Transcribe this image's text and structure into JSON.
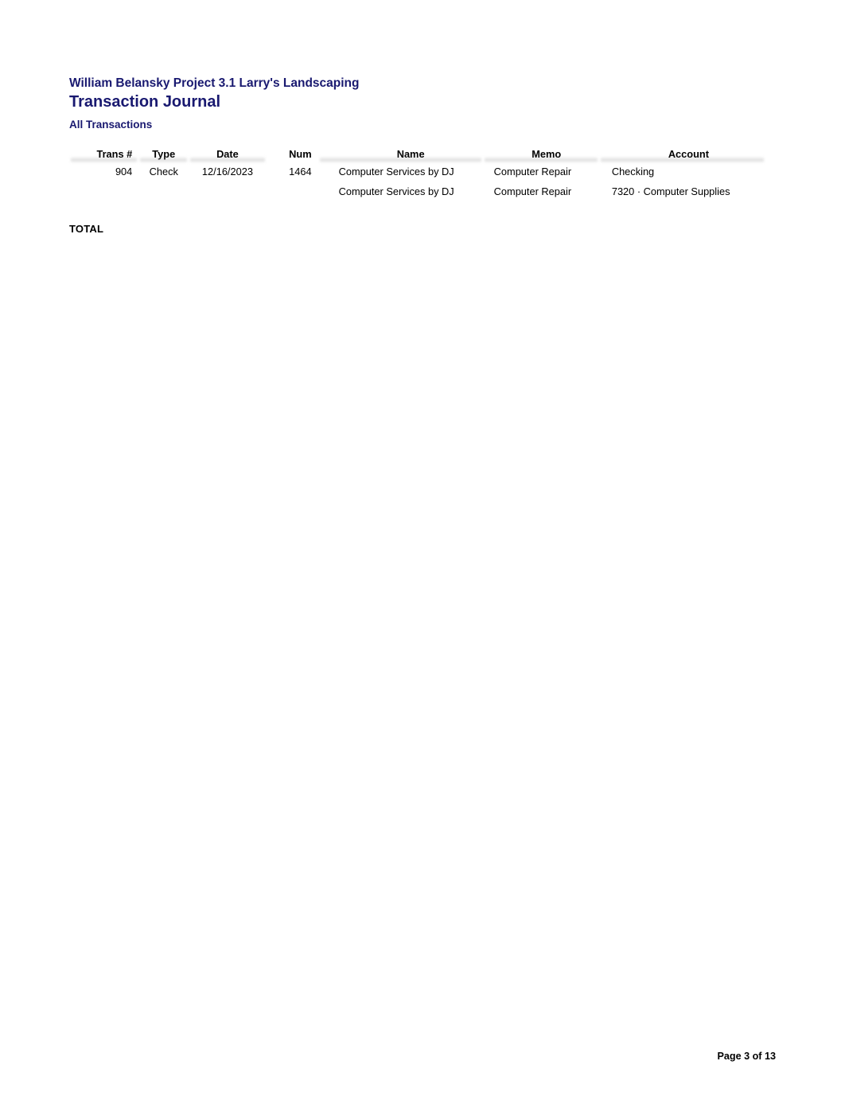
{
  "report": {
    "company_line": "William Belansky Project 3.1 Larry's Landscaping",
    "title": "Transaction Journal",
    "subtitle": "All Transactions",
    "accent_color": "#191970",
    "text_color": "#000000",
    "background_color": "#ffffff"
  },
  "table": {
    "columns": [
      {
        "key": "trans_no",
        "label": "Trans #"
      },
      {
        "key": "type",
        "label": "Type"
      },
      {
        "key": "date",
        "label": "Date"
      },
      {
        "key": "num",
        "label": "Num"
      },
      {
        "key": "name",
        "label": "Name"
      },
      {
        "key": "memo",
        "label": "Memo"
      },
      {
        "key": "account",
        "label": "Account"
      }
    ],
    "rows": [
      {
        "trans_no": "904",
        "type": "Check",
        "date": "12/16/2023",
        "num": "1464",
        "name": "Computer Services by DJ",
        "memo": "Computer Repair",
        "account": "Checking"
      },
      {
        "trans_no": "",
        "type": "",
        "date": "",
        "num": "",
        "name": "Computer Services by DJ",
        "memo": "Computer Repair",
        "account": "7320 · Computer Supplies"
      }
    ]
  },
  "total": {
    "label": "TOTAL",
    "value": ""
  },
  "footer": {
    "page_label": "Page 3 of 13",
    "page_number": 3,
    "page_count": 13
  }
}
